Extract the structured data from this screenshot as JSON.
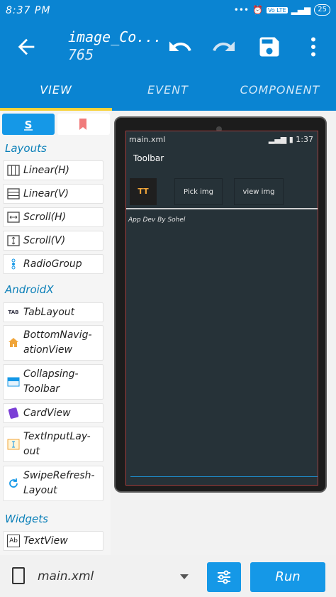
{
  "status_bar": {
    "time": "8:37 PM",
    "battery": "25",
    "network": "Vo LTE"
  },
  "appbar": {
    "title": "image_Co...",
    "subtitle": "765",
    "icons": [
      "back-arrow-icon",
      "undo-icon",
      "redo-icon",
      "save-icon",
      "more-vert-icon"
    ]
  },
  "tabs": [
    {
      "label": "VIEW",
      "active": true
    },
    {
      "label": "EVENT",
      "active": false
    },
    {
      "label": "COMPONENT",
      "active": false
    }
  ],
  "palette": {
    "tab_icons": [
      "widgets-s-icon",
      "bookmark-icon"
    ],
    "sections": [
      {
        "title": "Layouts",
        "items": [
          "Linear(H)",
          "Linear(V)",
          "Scroll(H)",
          "Scroll(V)",
          "RadioGroup"
        ]
      },
      {
        "title": "AndroidX",
        "items": [
          "TabLayout",
          "BottomNavigationView",
          "Collapsing-Toolbar",
          "CardView",
          "TextInputLayout",
          "SwipeRefresh-Layout"
        ]
      },
      {
        "title": "Widgets",
        "items": [
          "TextView"
        ]
      }
    ],
    "item_lines": {
      "bottom_nav": [
        "BottomNavig-",
        "ationView"
      ],
      "collapsing": [
        "Collapsing-",
        "Toolbar"
      ],
      "textinput": [
        "TextInputLay-",
        "out"
      ],
      "swipe": [
        "SwipeRefresh-",
        "Layout"
      ]
    }
  },
  "preview": {
    "file_name": "main.xml",
    "time": "1:37",
    "toolbar_title": "Toolbar",
    "image_placeholder": "TT",
    "buttons": [
      "Pick img",
      "view img"
    ],
    "text": "App Dev By Sohel"
  },
  "bottom_bar": {
    "file": "main.xml",
    "run_label": "Run"
  },
  "colors": {
    "primary": "#0a84d2",
    "accent": "#1598e7",
    "indicator": "#f7d23a",
    "preview_bg": "#263238"
  }
}
